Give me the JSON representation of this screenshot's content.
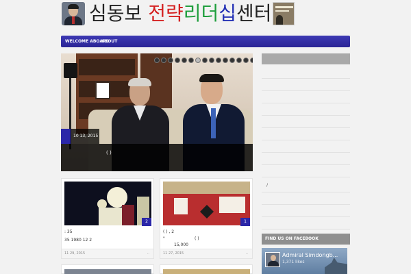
{
  "header": {
    "title_parts": [
      {
        "text": "심동보 ",
        "color": "#222222"
      },
      {
        "text": "전략",
        "color": "#d42020"
      },
      {
        "text": "리더",
        "color": "#1e9e3c"
      },
      {
        "text": "십",
        "color": "#2431b5"
      },
      {
        "text": "센터",
        "color": "#222222"
      }
    ]
  },
  "nav": {
    "items": [
      "WELCOME ABOARD",
      "ABOUT"
    ]
  },
  "slider": {
    "date": "10   13, 2015",
    "caption": "(                          )",
    "dot_count": 24,
    "active_dot": 6
  },
  "posts": [
    {
      "count": "2",
      "line1": ":                                 35",
      "line2": "35       1980      12     2",
      "date": "11    29, 2015",
      "more": ".."
    },
    {
      "count": "1",
      "line1": "( )                   ,              2",
      "line2": "\"",
      "line3": "( )",
      "line4": "15,000",
      "date": "11    27, 2015",
      "more": ".."
    }
  ],
  "sidebar": {
    "slash": "/",
    "facebook": {
      "heading": "FIND US ON FACEBOOK",
      "page_name": "Admiral Simdongb...",
      "likes": "1,371 likes"
    }
  },
  "colors": {
    "accent": "#2b27a8",
    "nav_gradient": [
      "#3d39b3",
      "#2a2496"
    ]
  }
}
